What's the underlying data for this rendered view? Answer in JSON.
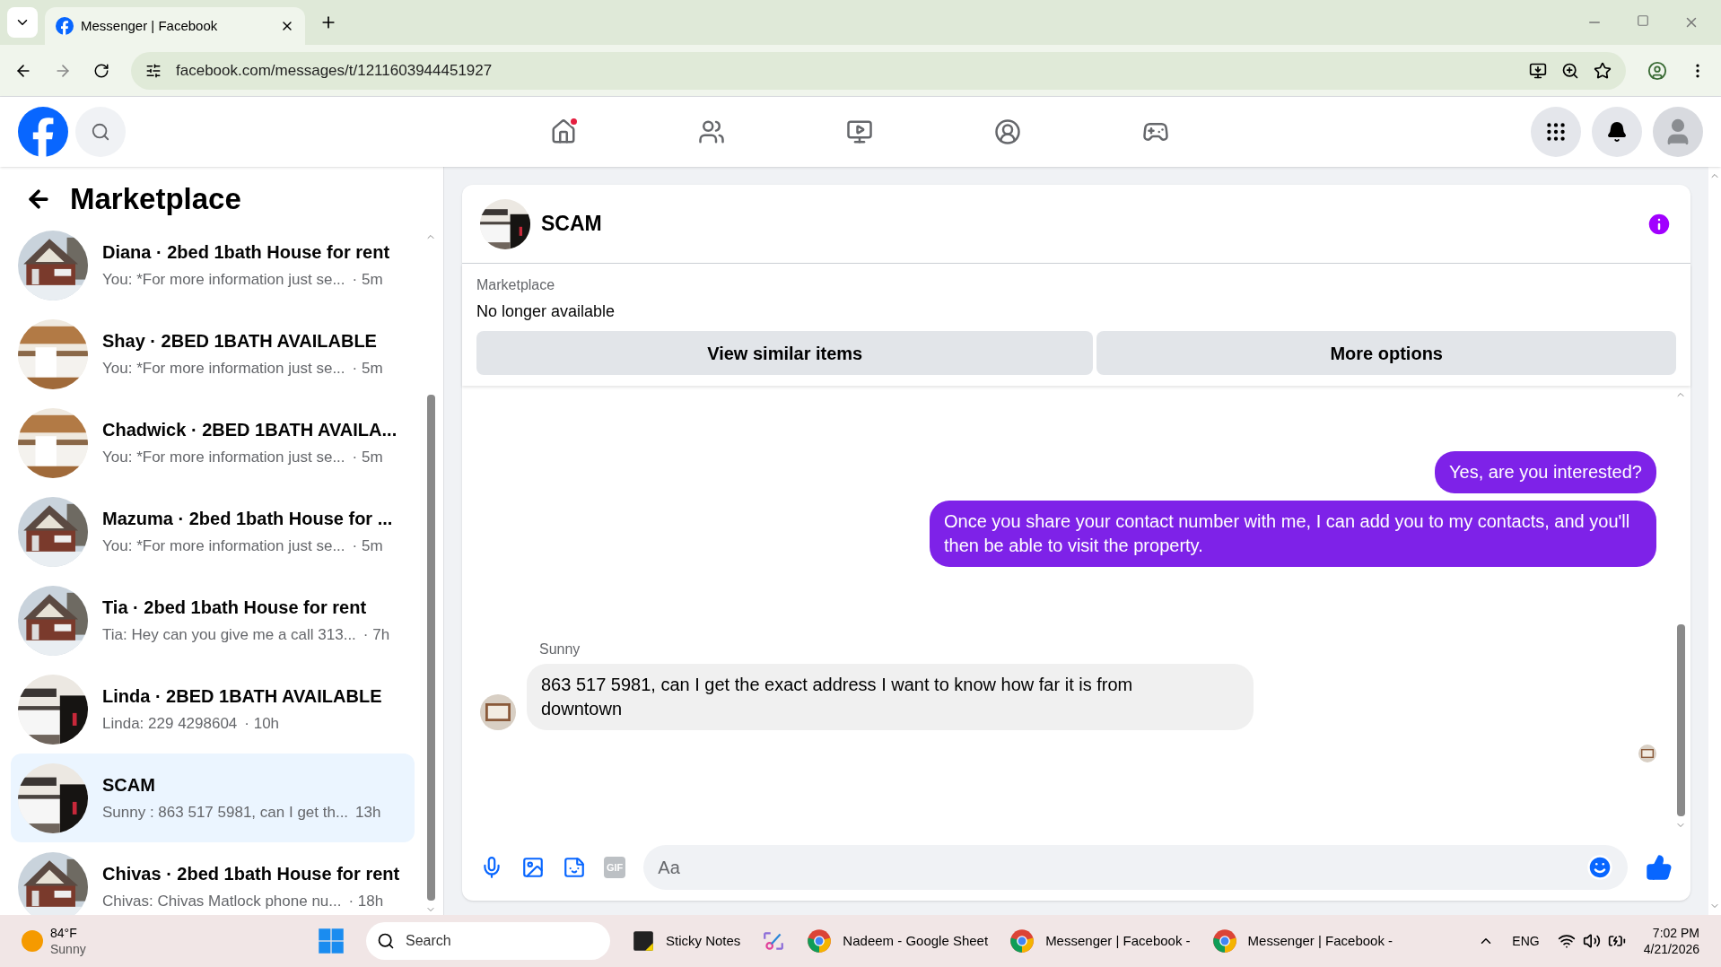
{
  "browser": {
    "tabs": [
      {
        "title": "Messenger | Facebook",
        "selected": true
      }
    ],
    "url": "facebook.com/messages/t/1211603944451927"
  },
  "nav": [
    {
      "kind": "home",
      "badge": true
    },
    {
      "kind": "friends",
      "badge": false
    },
    {
      "kind": "video",
      "badge": false
    },
    {
      "kind": "groups",
      "badge": false
    },
    {
      "kind": "gaming",
      "badge": false
    }
  ],
  "sidebar": {
    "title": "Marketplace",
    "conversations": [
      {
        "name": "Diana · 2bed 1bath House for rent",
        "preview": "You: *For more information just se...",
        "time": "· 5m",
        "selected": false
      },
      {
        "name": "Shay · 2BED 1BATH AVAILABLE",
        "preview": "You: *For more information just se...",
        "time": "· 5m",
        "selected": false
      },
      {
        "name": "Chadwick · 2BED 1BATH AVAILA...",
        "preview": "You: *For more information just se...",
        "time": "· 5m",
        "selected": false
      },
      {
        "name": "Mazuma · 2bed 1bath House for ...",
        "preview": "You: *For more information just se...",
        "time": "· 5m",
        "selected": false
      },
      {
        "name": "Tia · 2bed 1bath House for rent",
        "preview": "Tia: Hey can you give me a call 313...",
        "time": "· 7h",
        "selected": false
      },
      {
        "name": "Linda · 2BED 1BATH AVAILABLE",
        "preview": "Linda: 229 4298604",
        "time": "· 10h",
        "selected": false
      },
      {
        "name": "SCAM",
        "preview": "Sunny : 863 517 5981, can I get th...",
        "time": "13h",
        "selected": true
      },
      {
        "name": "Chivas · 2bed 1bath House for rent",
        "preview": "Chivas: Chivas Matlock phone nu...",
        "time": "· 18h",
        "selected": false
      }
    ]
  },
  "chat": {
    "title": "SCAM",
    "listing_label": "Marketplace",
    "listing_status": "No longer available",
    "actions": [
      "View similar items",
      "More options"
    ],
    "messages": [
      {
        "kind": "sent",
        "text": "Yes, are you interested?"
      },
      {
        "kind": "sent",
        "text": "Once you share your contact number with me, I can add you to my contacts, and you'll then be able to visit the property."
      },
      {
        "kind": "received",
        "sender": "Sunny",
        "text": "863 517 5981, can I get the exact address I want to know how far it is from downtown"
      }
    ],
    "composer": {
      "placeholder": "Aa",
      "gif_label": "GIF"
    }
  },
  "taskbar": {
    "temperature": "84°F",
    "condition": "Sunny",
    "search_placeholder": "Search",
    "apps": [
      {
        "kind": "sticky",
        "label": "Sticky Notes"
      },
      {
        "kind": "snip"
      },
      {
        "kind": "chrome",
        "label": "Nadeem - Google Sheet"
      },
      {
        "kind": "chrome",
        "label": "Messenger | Facebook -"
      },
      {
        "kind": "chrome",
        "label": "Messenger | Facebook -"
      }
    ],
    "language": "ENG",
    "time": "7:02 PM",
    "date": "4/21/2026"
  }
}
